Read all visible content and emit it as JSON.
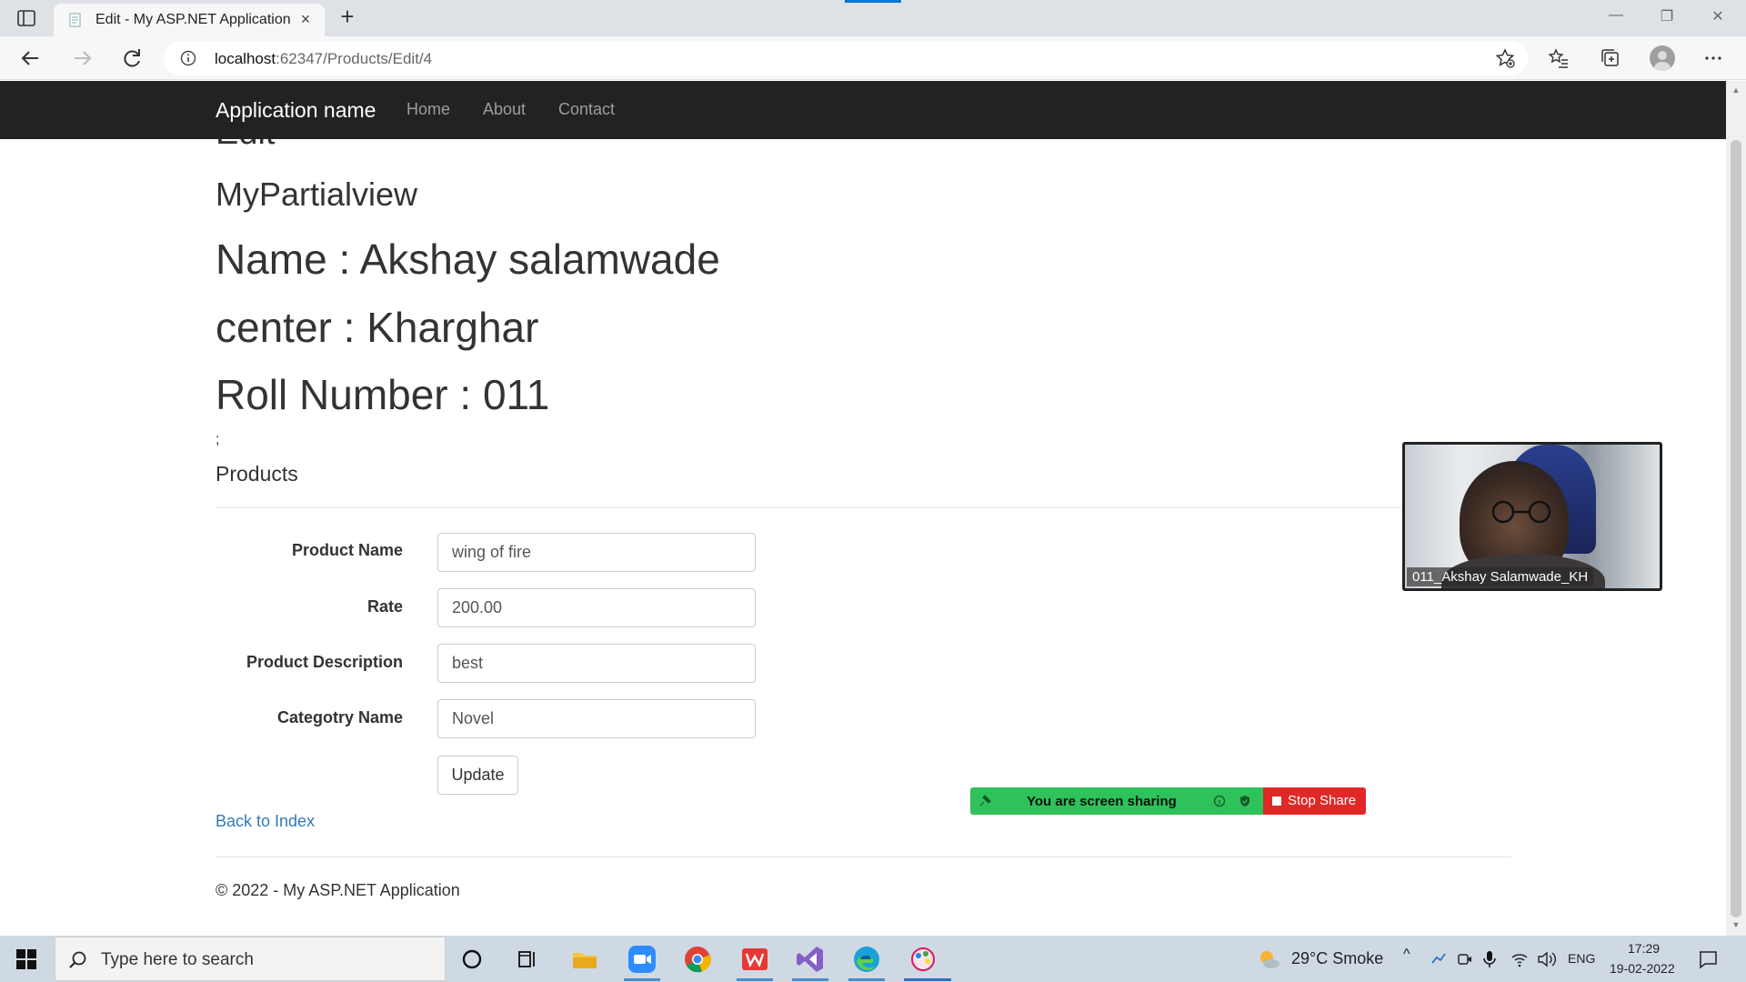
{
  "browser": {
    "tab_title": "Edit - My ASP.NET Application",
    "url_host": "localhost",
    "url_rest": ":62347/Products/Edit/4"
  },
  "site": {
    "brand": "Application name",
    "nav": {
      "home": "Home",
      "about": "About",
      "contact": "Contact"
    },
    "edit_heading": "Edit",
    "partial_title": "MyPartialview",
    "name_line": "Name : Akshay salamwade",
    "center_line": "center : Kharghar",
    "roll_line": "Roll Number : 011",
    "semicolon": ";",
    "products_heading": "Products",
    "form": {
      "product_name_label": "Product Name",
      "product_name_value": "wing of fire",
      "rate_label": "Rate",
      "rate_value": "200.00",
      "description_label": "Product Description",
      "description_value": "best",
      "category_label": "Categotry Name",
      "category_value": "Novel",
      "update_label": "Update"
    },
    "back_link": "Back to Index",
    "footer": "© 2022 - My ASP.NET Application"
  },
  "zoom": {
    "participant_name": "011_Akshay Salamwade_KH",
    "sharing_text": "You are screen sharing",
    "stop_share": "Stop Share"
  },
  "taskbar": {
    "search_placeholder": "Type here to search",
    "weather": "29°C  Smoke",
    "language": "ENG",
    "time": "17:29",
    "date": "19-02-2022"
  },
  "colors": {
    "site_nav_bg": "#222222",
    "link_blue": "#337ab7",
    "share_green": "#2fc25b",
    "stop_red": "#e02828"
  }
}
